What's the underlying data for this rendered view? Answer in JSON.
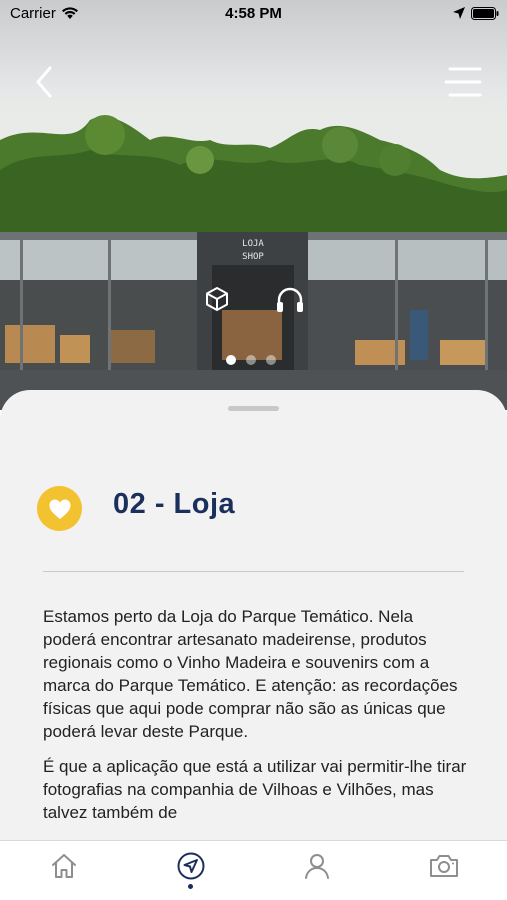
{
  "status_bar": {
    "carrier": "Carrier",
    "time": "4:58 PM"
  },
  "hero": {
    "sign_line1": "LOJA",
    "sign_line2": "SHOP",
    "carousel_count": 3,
    "carousel_active_index": 0
  },
  "point": {
    "title": "02 - Loja",
    "paragraphs": [
      "Estamos perto da Loja do Parque Temático. Nela poderá encontrar artesanato madeirense, produtos regionais como o Vinho Madeira e souvenirs com a marca do Parque Temático. E atenção: as recordações físicas que aqui pode comprar não são as únicas que poderá levar deste Parque.",
      "É que a aplicação que está a utilizar vai permitir-lhe tirar fotografias na companhia de Vilhoas e Vilhões, mas talvez também de"
    ]
  },
  "tabs": [
    {
      "icon": "home-icon"
    },
    {
      "icon": "navigation-icon",
      "active": true
    },
    {
      "icon": "profile-icon"
    },
    {
      "icon": "camera-icon"
    }
  ],
  "colors": {
    "accent_yellow": "#f2c230",
    "title_navy": "#1b2f5c",
    "sheet_bg": "#f2f2f2"
  }
}
